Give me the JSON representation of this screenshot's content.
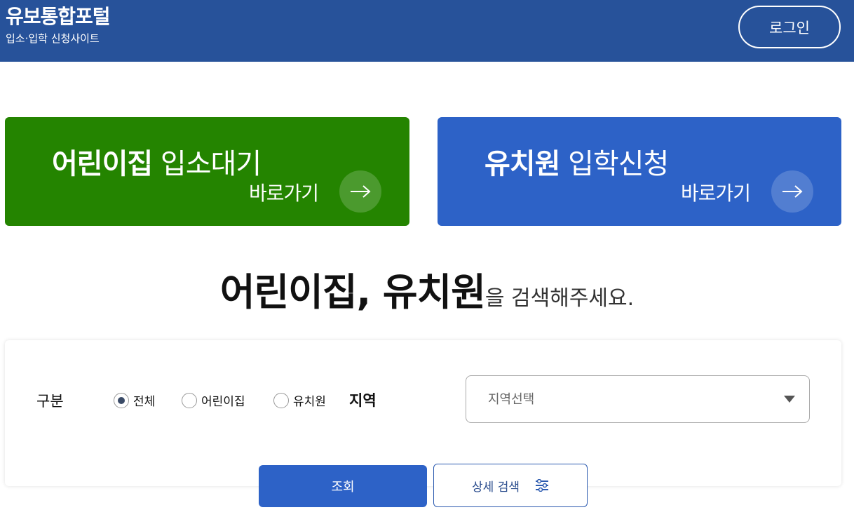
{
  "header": {
    "title": "유보통합포털",
    "subtitle": "입소·입학 신청사이트",
    "login_label": "로그인"
  },
  "banners": {
    "daycare": {
      "title_bold": "어린이집",
      "title_light": "입소대기",
      "goto": "바로가기",
      "color": "#248400"
    },
    "kindergarten": {
      "title_bold": "유치원",
      "title_light": "입학신청",
      "goto": "바로가기",
      "color": "#2d62c7"
    }
  },
  "headline": {
    "bold": "어린이집, 유치원",
    "rest": "을 검색해주세요."
  },
  "search": {
    "type_label": "구분",
    "options": [
      "전체",
      "어린이집",
      "유치원"
    ],
    "selected": "전체",
    "region_label": "지역",
    "region_placeholder": "지역선택",
    "submit_label": "조회",
    "detail_label": "상세 검색"
  },
  "icons": {
    "arrow": "arrow-right-icon",
    "caret": "chevron-down-icon",
    "filter": "sliders-icon"
  }
}
